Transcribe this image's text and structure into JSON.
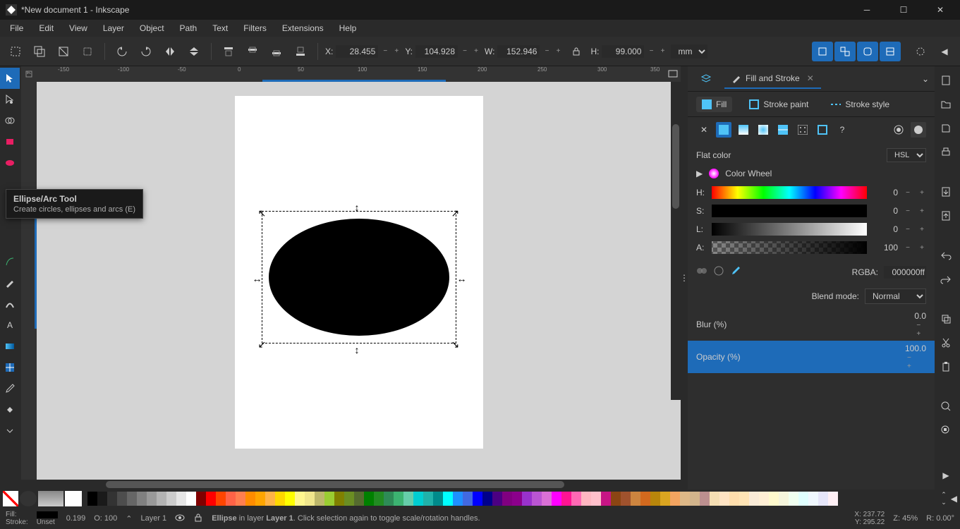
{
  "titlebar": {
    "title": "*New document 1 - Inkscape"
  },
  "menu": [
    "File",
    "Edit",
    "View",
    "Layer",
    "Object",
    "Path",
    "Text",
    "Filters",
    "Extensions",
    "Help"
  ],
  "toolbar": {
    "x_label": "X:",
    "x": "28.455",
    "y_label": "Y:",
    "y": "104.928",
    "w_label": "W:",
    "w": "152.946",
    "h_label": "H:",
    "h": "99.000",
    "unit": "mm"
  },
  "tooltip": {
    "title": "Ellipse/Arc Tool",
    "desc": "Create circles, ellipses and arcs (E)"
  },
  "dock": {
    "tab_label": "Fill and Stroke",
    "fill_tab": "Fill",
    "stroke_paint_tab": "Stroke paint",
    "stroke_style_tab": "Stroke style",
    "flat_color": "Flat color",
    "mode": "HSL",
    "color_wheel": "Color Wheel",
    "h_label": "H:",
    "h_val": "0",
    "s_label": "S:",
    "s_val": "0",
    "l_label": "L:",
    "l_val": "0",
    "a_label": "A:",
    "a_val": "100",
    "rgba_label": "RGBA:",
    "rgba_val": "000000ff",
    "blend_label": "Blend mode:",
    "blend_val": "Normal",
    "blur_label": "Blur (%)",
    "blur_val": "0.0",
    "opacity_label": "Opacity (%)",
    "opacity_val": "100.0"
  },
  "status": {
    "fill_label": "Fill:",
    "stroke_label": "Stroke:",
    "stroke_val": "Unset",
    "stroke_width": "0.199",
    "o_label": "O:",
    "o_val": "100",
    "layer": "Layer 1",
    "msg_shape": "Ellipse",
    "msg_in": " in layer ",
    "msg_layer": "Layer 1",
    "msg_rest": ". Click selection again to toggle scale/rotation handles.",
    "x_label": "X:",
    "x_val": "237.72",
    "y_label": "Y:",
    "y_val": "295.22",
    "z_label": "Z:",
    "z_val": "45%",
    "r_label": "R:",
    "r_val": "0.00°"
  },
  "ruler_h": [
    "-150",
    "-100",
    "-50",
    "0",
    "50",
    "100",
    "150",
    "200",
    "250",
    "300",
    "350"
  ],
  "palette_grays": [
    "#000000",
    "#1a1a1a",
    "#333333",
    "#4d4d4d",
    "#666666",
    "#808080",
    "#999999",
    "#b3b3b3",
    "#cccccc",
    "#e6e6e6",
    "#ffffff"
  ],
  "palette_colors": [
    "#800000",
    "#ff0000",
    "#ff4500",
    "#ff6347",
    "#ff7f50",
    "#ff8c00",
    "#ffa500",
    "#ffb347",
    "#ffd700",
    "#ffff00",
    "#fff68f",
    "#f0e68c",
    "#bdb76b",
    "#9acd32",
    "#808000",
    "#6b8e23",
    "#556b2f",
    "#008000",
    "#228b22",
    "#2e8b57",
    "#3cb371",
    "#66cdaa",
    "#00ced1",
    "#20b2aa",
    "#008b8b",
    "#00ffff",
    "#1e90ff",
    "#4169e1",
    "#0000ff",
    "#00008b",
    "#4b0082",
    "#800080",
    "#8b008b",
    "#9932cc",
    "#ba55d3",
    "#da70d6",
    "#ff00ff",
    "#ff1493",
    "#ff69b4",
    "#ffb6c1",
    "#ffc0cb",
    "#c71585",
    "#8b4513",
    "#a0522d",
    "#cd853f",
    "#d2691e",
    "#b8860b",
    "#daa520",
    "#f4a460",
    "#deb887",
    "#d2b48c",
    "#bc8f8f",
    "#f5deb3",
    "#ffe4c4",
    "#ffdead",
    "#ffe4b5",
    "#faebd7",
    "#ffefd5",
    "#fffacd",
    "#f5f5dc",
    "#f0fff0",
    "#e0ffff",
    "#f0f8ff",
    "#e6e6fa",
    "#fff0f5"
  ]
}
